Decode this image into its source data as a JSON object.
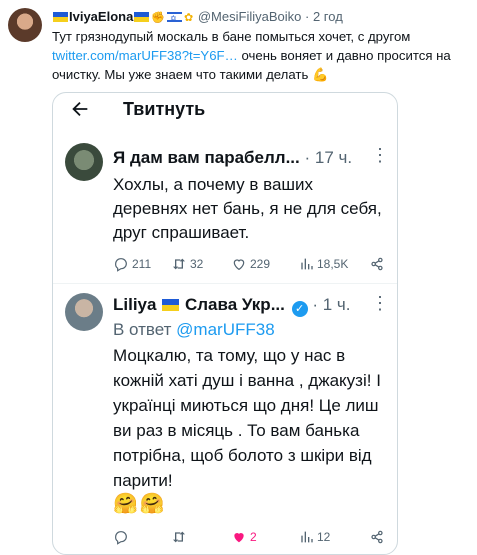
{
  "outer": {
    "name": "IviyaElona",
    "handle": "@MesiFiliyaBoiko",
    "separator": "·",
    "time": "2 год",
    "text_before_link": "Тут грязнодупый москаль в бане помыться хочет, с другом ",
    "link": "twitter.com/marUFF38?t=Y6F…",
    "text_after_link": " очень воняет и давно просится на очистку. Мы уже знаем что такими делать",
    "icons": [
      "flag-ukraine-icon",
      "fist-icon",
      "flag-israel-icon",
      "sunflower-icon",
      "flexed-biceps-icon"
    ]
  },
  "screenshot": {
    "header_title": "Твитнуть",
    "tweet1": {
      "name": "Я дам вам парабелл...",
      "separator": "·",
      "time": "17 ч.",
      "more": "⋮",
      "text": "Хохлы, а почему в ваших деревнях нет бань, я не для себя, друг спрашивает.",
      "replies": "211",
      "retweets": "32",
      "likes": "229",
      "views": "18,5K"
    },
    "tweet2": {
      "name": "Liliya",
      "name_suffix": "Слава Укр...",
      "separator": "·",
      "time": "1 ч.",
      "more": "⋮",
      "reply_prefix": "В ответ ",
      "reply_to": "@marUFF38",
      "text": "Моцкалю, та тому, що у нас в кожній хаті душ і ванна , джакузі! І українці миються що дня! Це лиш ви раз в місяць . То вам банька потрібна, щоб болото з шкіри від парити!",
      "emoji": "🤗🤗",
      "replies": "",
      "retweets": "",
      "likes": "2",
      "views": "12"
    }
  },
  "colors": {
    "text": "#0f1419",
    "muted": "#536471",
    "link": "#1d9bf0",
    "like_active": "#f91880",
    "border": "#cfd9de"
  }
}
